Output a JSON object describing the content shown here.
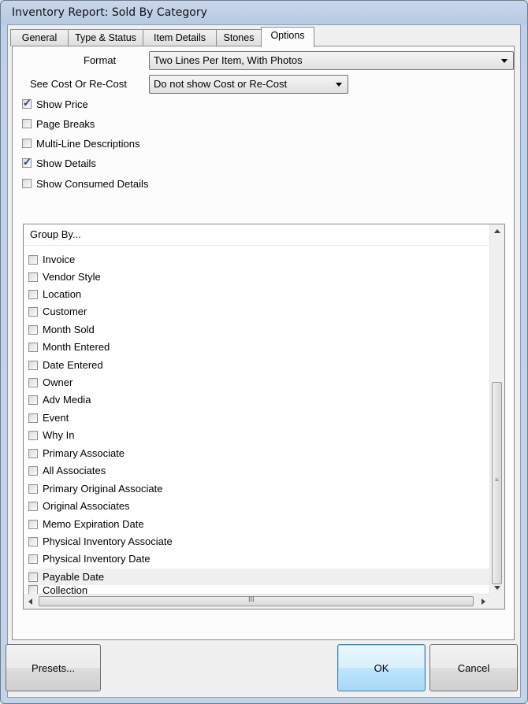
{
  "window": {
    "title": "Inventory Report: Sold By Category"
  },
  "tabs": [
    {
      "label": "General"
    },
    {
      "label": "Type & Status"
    },
    {
      "label": "Item Details"
    },
    {
      "label": "Stones"
    },
    {
      "label": "Options"
    }
  ],
  "options": {
    "format_label": "Format",
    "format_value": "Two Lines Per Item, With Photos",
    "cost_label": "See Cost Or Re-Cost",
    "cost_value": "Do not show Cost or Re-Cost",
    "checkboxes": [
      {
        "label": "Show Price",
        "checked": true
      },
      {
        "label": "Page Breaks",
        "checked": false
      },
      {
        "label": "Multi-Line Descriptions",
        "checked": false
      },
      {
        "label": "Show Details",
        "checked": true
      },
      {
        "label": "Show Consumed Details",
        "checked": false
      }
    ]
  },
  "group_by": {
    "header": "Group By...",
    "items": [
      {
        "label": "Invoice",
        "checked": false
      },
      {
        "label": "Vendor Style",
        "checked": false
      },
      {
        "label": "Location",
        "checked": false
      },
      {
        "label": "Customer",
        "checked": false
      },
      {
        "label": "Month Sold",
        "checked": false
      },
      {
        "label": "Month Entered",
        "checked": false
      },
      {
        "label": "Date Entered",
        "checked": false
      },
      {
        "label": "Owner",
        "checked": false
      },
      {
        "label": "Adv Media",
        "checked": false
      },
      {
        "label": "Event",
        "checked": false
      },
      {
        "label": "Why In",
        "checked": false
      },
      {
        "label": "Primary Associate",
        "checked": false
      },
      {
        "label": "All Associates",
        "checked": false
      },
      {
        "label": "Primary Original Associate",
        "checked": false
      },
      {
        "label": "Original Associates",
        "checked": false
      },
      {
        "label": "Memo Expiration Date",
        "checked": false
      },
      {
        "label": "Physical Inventory Associate",
        "checked": false
      },
      {
        "label": "Physical Inventory Date",
        "checked": false
      },
      {
        "label": "Payable Date",
        "checked": false
      },
      {
        "label": "Collection",
        "checked": false
      }
    ],
    "hscroll_grip": "III"
  },
  "buttons": {
    "presets": "Presets...",
    "ok": "OK",
    "cancel": "Cancel"
  }
}
